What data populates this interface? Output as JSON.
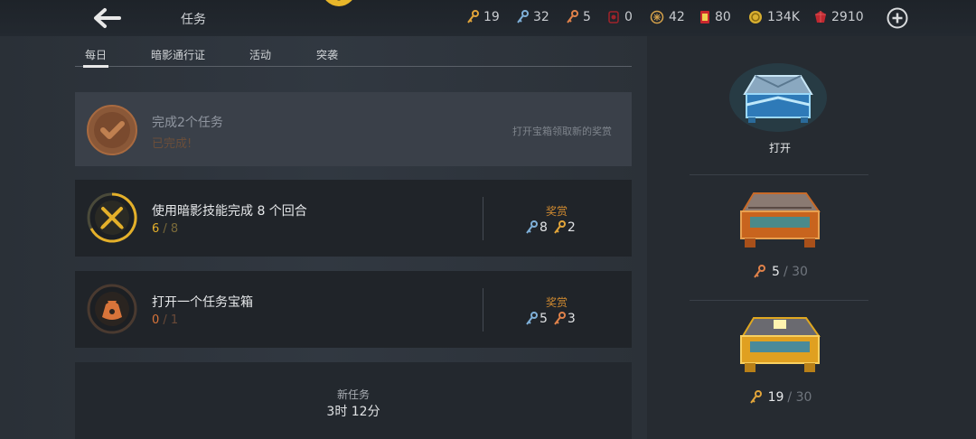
{
  "header": {
    "title": "任务",
    "currencies": [
      {
        "name": "gold-key",
        "value": "19",
        "color": "#e2a53a"
      },
      {
        "name": "blue-key",
        "value": "32",
        "color": "#7fb0d8"
      },
      {
        "name": "orange-key",
        "value": "5",
        "color": "#e0824a"
      },
      {
        "name": "red-token",
        "value": "0",
        "color": "#a0232a"
      },
      {
        "name": "emblem-coin",
        "value": "42",
        "color": "#d6a24a"
      },
      {
        "name": "ticket",
        "value": "80",
        "color": "#c9282e"
      },
      {
        "name": "coin",
        "value": "134K",
        "color": "#d9b030"
      },
      {
        "name": "ruby",
        "value": "2910",
        "color": "#c02830"
      }
    ]
  },
  "tabs": [
    {
      "label": "每日",
      "active": true
    },
    {
      "label": "暗影通行证",
      "active": false
    },
    {
      "label": "活动",
      "active": false
    },
    {
      "label": "突袭",
      "active": false
    }
  ],
  "quests": {
    "completed": {
      "title": "完成2个任务",
      "status": "已完成!",
      "hint": "打开宝箱领取新的奖赏"
    },
    "q1": {
      "title": "使用暗影技能完成 8 个回合",
      "progress": "6",
      "total": "/ 8",
      "reward_label": "奖赏",
      "rewards": [
        "8",
        "2"
      ]
    },
    "q2": {
      "title": "打开一个任务宝箱",
      "progress": "0",
      "total": "/ 1",
      "reward_label": "奖赏",
      "rewards": [
        "5",
        "3"
      ]
    },
    "new": {
      "label": "新任务",
      "time": "3时 12分"
    }
  },
  "chests": {
    "open_label": "打开",
    "orange": {
      "have": "5",
      "need": "/ 30"
    },
    "gold": {
      "have": "19",
      "need": "/ 30"
    }
  }
}
